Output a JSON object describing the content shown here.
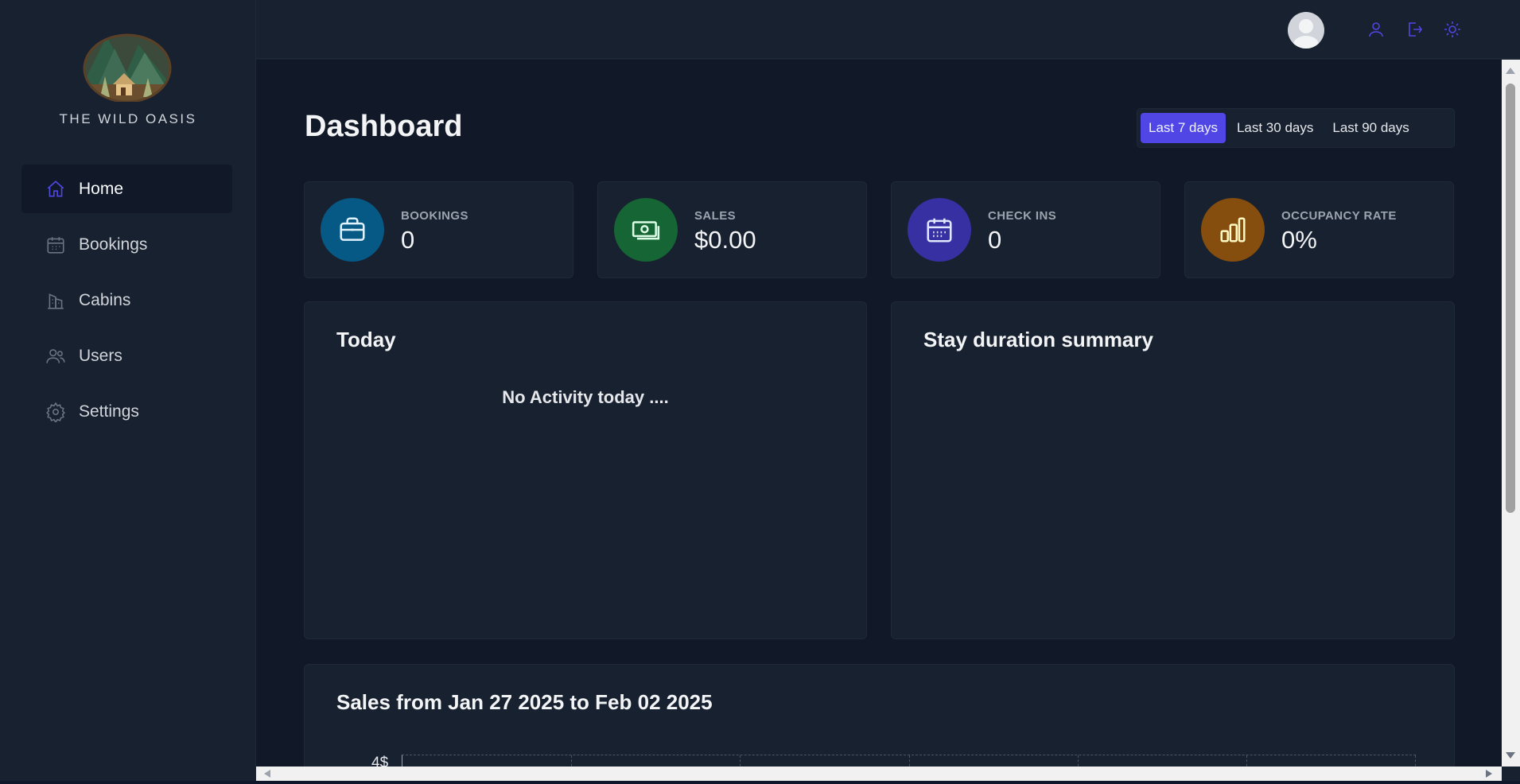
{
  "brand": {
    "name": "THE WILD OASIS",
    "logo_icon": "cabin-mountain-logo"
  },
  "header": {
    "avatar_icon": "user-avatar",
    "icons": [
      "user-icon",
      "logout-icon",
      "sun-icon"
    ],
    "accent": "#4f46e5"
  },
  "sidebar": {
    "items": [
      {
        "label": "Home",
        "icon": "home-icon",
        "active": true
      },
      {
        "label": "Bookings",
        "icon": "calendar-icon",
        "active": false
      },
      {
        "label": "Cabins",
        "icon": "building-icon",
        "active": false
      },
      {
        "label": "Users",
        "icon": "users-icon",
        "active": false
      },
      {
        "label": "Settings",
        "icon": "gear-icon",
        "active": false
      }
    ]
  },
  "main": {
    "title": "Dashboard",
    "filter": {
      "options": [
        "Last 7 days",
        "Last 30 days",
        "Last 90 days"
      ],
      "selected": "Last 7 days"
    },
    "stats": [
      {
        "label": "BOOKINGS",
        "value": "0",
        "icon": "briefcase-icon",
        "color": "#075985",
        "icon_color": "#e0f2fe"
      },
      {
        "label": "SALES",
        "value": "$0.00",
        "icon": "banknotes-icon",
        "color": "#166534",
        "icon_color": "#dcfce7"
      },
      {
        "label": "CHECK INS",
        "value": "0",
        "icon": "calendar-days-icon",
        "color": "#3730a3",
        "icon_color": "#e0e7ff"
      },
      {
        "label": "OCCUPANCY RATE",
        "value": "0%",
        "icon": "chart-bar-icon",
        "color": "#854d0e",
        "icon_color": "#fef9c3"
      }
    ],
    "today": {
      "title": "Today",
      "empty_message": "No Activity today ...."
    },
    "duration": {
      "title": "Stay duration summary"
    },
    "sales": {
      "title": "Sales from Jan 27 2025 to Feb 02 2025",
      "y_tick": "4$"
    }
  }
}
